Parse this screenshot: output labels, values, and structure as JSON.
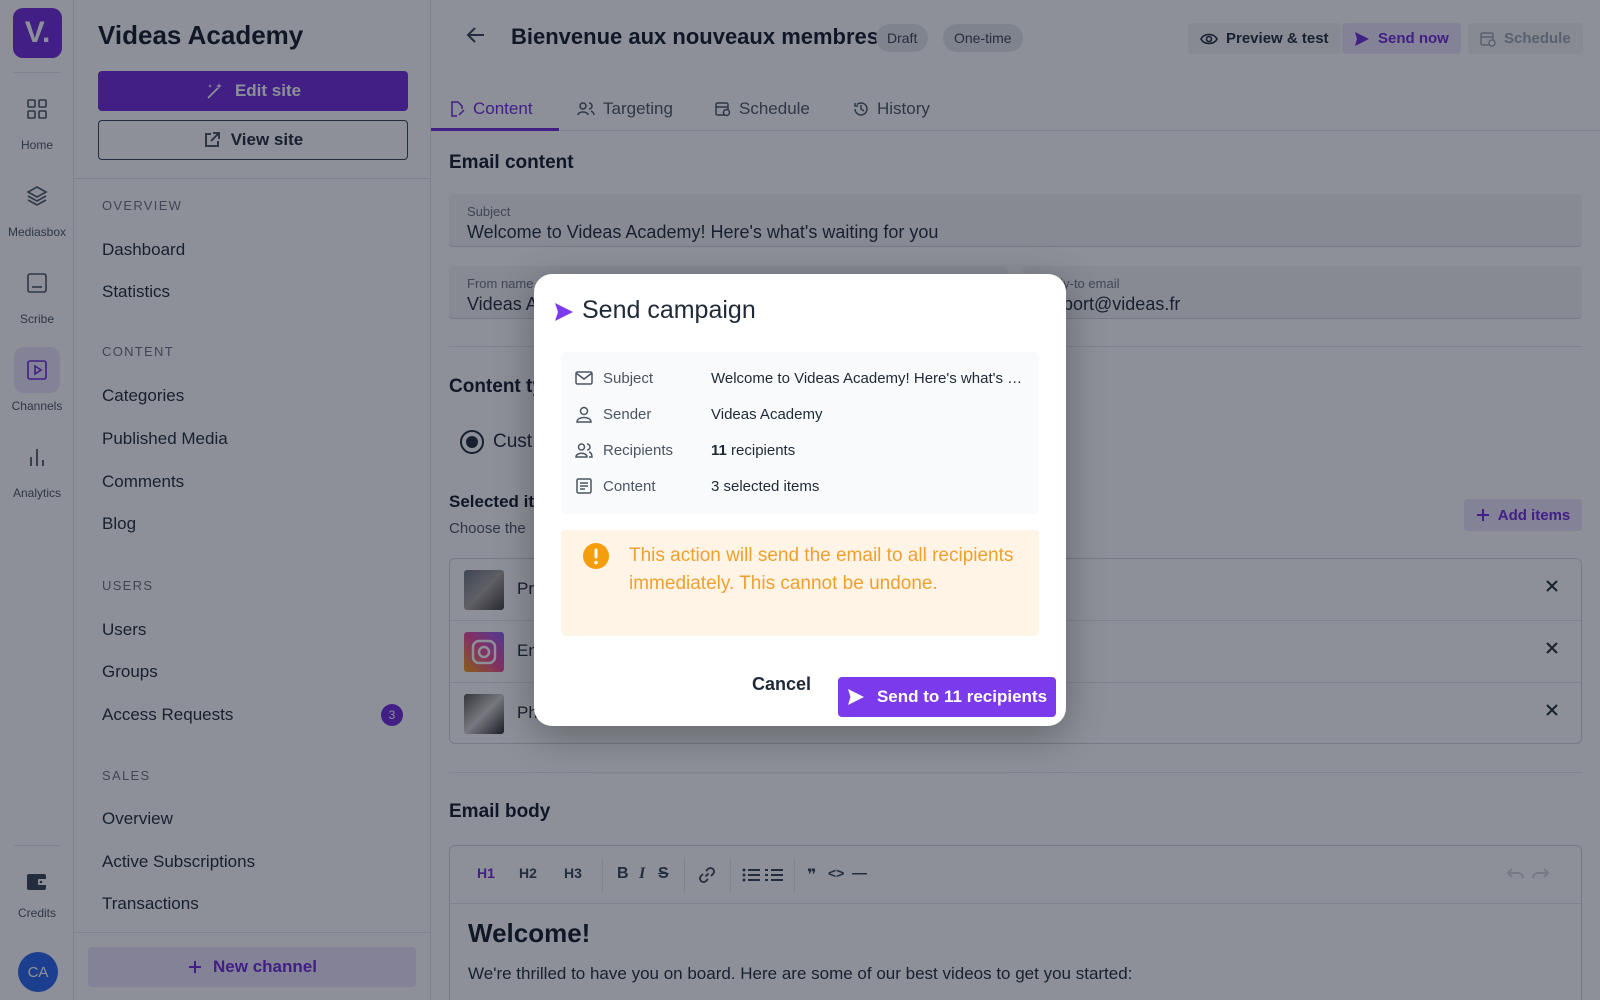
{
  "rail": {
    "logo": "V.",
    "items": [
      {
        "label": "Home"
      },
      {
        "label": "Mediasbox"
      },
      {
        "label": "Scribe"
      },
      {
        "label": "Channels"
      },
      {
        "label": "Analytics"
      },
      {
        "label": "Credits"
      }
    ],
    "avatar": "CA"
  },
  "sidebar": {
    "title": "Videas Academy",
    "edit_site": "Edit site",
    "view_site": "View site",
    "sections": {
      "overview": "OVERVIEW",
      "content": "CONTENT",
      "users": "USERS",
      "sales": "SALES"
    },
    "items": {
      "dashboard": "Dashboard",
      "statistics": "Statistics",
      "categories": "Categories",
      "published_media": "Published Media",
      "comments": "Comments",
      "blog": "Blog",
      "users": "Users",
      "groups": "Groups",
      "access_requests": "Access Requests",
      "sales_overview": "Overview",
      "active_subscriptions": "Active Subscriptions",
      "transactions": "Transactions"
    },
    "access_requests_badge": "3",
    "new_channel": "New channel"
  },
  "header": {
    "title": "Bienvenue aux nouveaux membres",
    "chip_status": "Draft",
    "chip_type": "One-time",
    "preview_test": "Preview & test",
    "send_now": "Send now",
    "schedule": "Schedule"
  },
  "tabs": [
    {
      "label": "Content"
    },
    {
      "label": "Targeting"
    },
    {
      "label": "Schedule"
    },
    {
      "label": "History"
    }
  ],
  "email_content": {
    "section_title": "Email content",
    "subject_label": "Subject",
    "subject_value": "Welcome to Videas Academy! Here's what's waiting for you",
    "from_label": "From name",
    "from_value": "Videas A",
    "reply_label": "ply-to email",
    "reply_value": "pport@videas.fr",
    "content_type_title": "Content ty",
    "radio_label": "Cust",
    "selected_title": "Selected it",
    "selected_sub": "Choose the",
    "add_items": "Add items",
    "rows": [
      {
        "text": "Pr"
      },
      {
        "text": "En"
      },
      {
        "text": "Ph"
      }
    ]
  },
  "email_body": {
    "section_title": "Email body",
    "toolbar": {
      "h1": "H1",
      "h2": "H2",
      "h3": "H3",
      "bold": "B",
      "italic": "I",
      "strike": "S",
      "quote": "❞",
      "code": "<>",
      "hr": "—"
    },
    "heading": "Welcome!",
    "paragraph": "We're thrilled to have you on board. Here are some of our best videos to get you started:"
  },
  "modal": {
    "title": "Send campaign",
    "rows": [
      {
        "key": "Subject",
        "value": "Welcome to Videas Academy! Here's what's waiting for you"
      },
      {
        "key": "Sender",
        "value": "Videas Academy"
      },
      {
        "key": "Recipients",
        "value_count": "11",
        "value_suffix": " recipients"
      },
      {
        "key": "Content",
        "value": "3 selected items"
      }
    ],
    "warning": "This action will send the email to all recipients immediately. This cannot be undone.",
    "cancel": "Cancel",
    "send": "Send to 11 recipients"
  },
  "colors": {
    "accent": "#6d28d9",
    "warning_bg": "#fff4e5",
    "warning_text": "#f0a030"
  }
}
